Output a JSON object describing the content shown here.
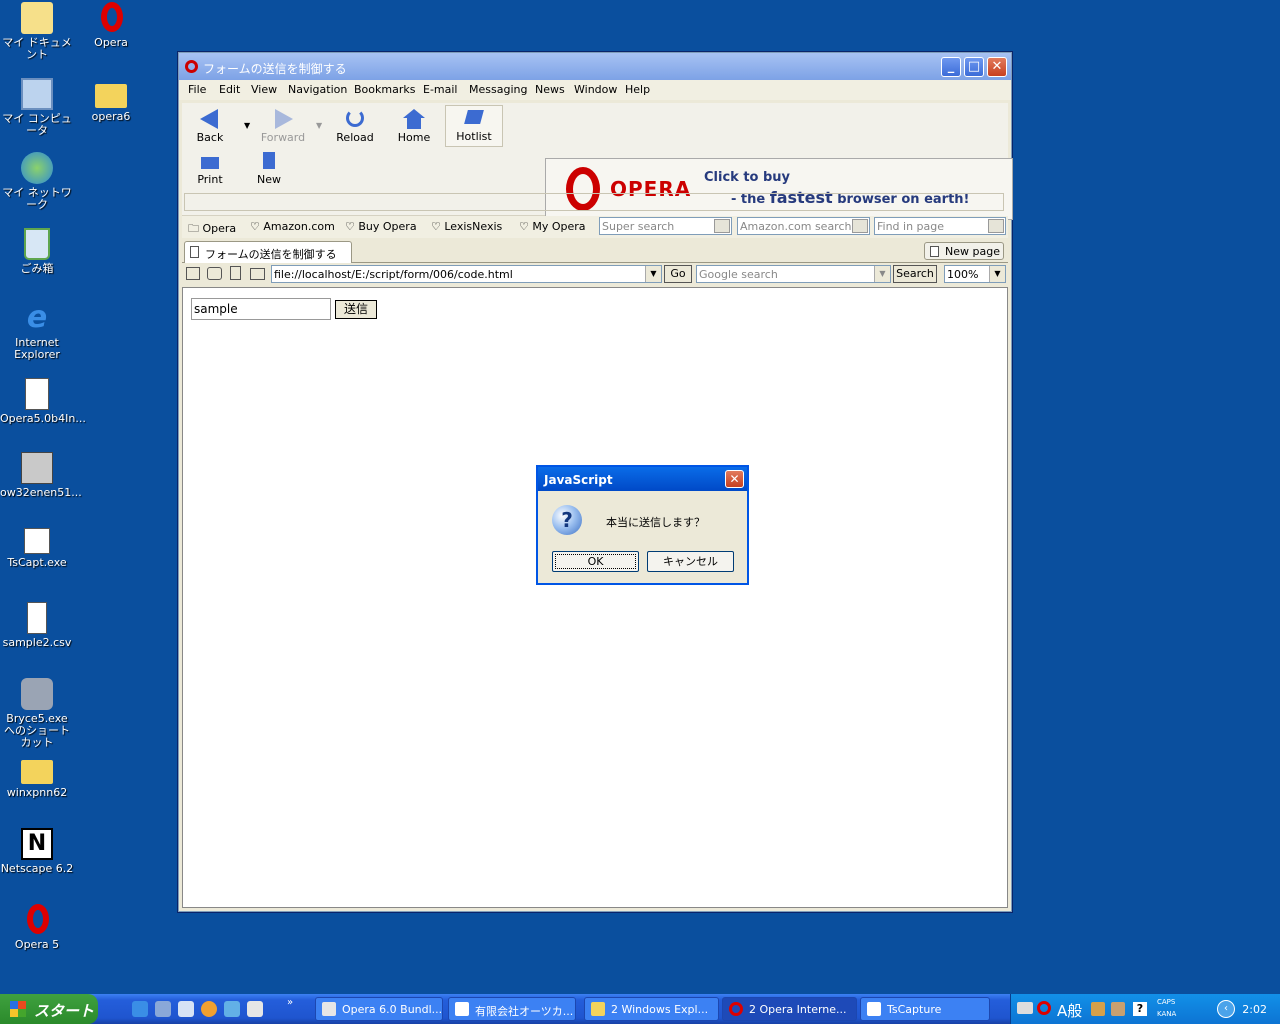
{
  "desktop": {
    "icons": [
      {
        "label": "マイ ドキュメント",
        "icon": "my-documents-icon"
      },
      {
        "label": "Opera",
        "icon": "opera-shortcut-icon"
      },
      {
        "label": "マイ コンピュータ",
        "icon": "my-computer-icon"
      },
      {
        "label": "opera6",
        "icon": "folder-icon"
      },
      {
        "label": "マイ ネットワーク",
        "icon": "my-network-icon"
      },
      {
        "label": "ごみ箱",
        "icon": "recycle-bin-icon"
      },
      {
        "label": "Internet Explorer",
        "icon": "ie-icon"
      },
      {
        "label": "Opera5.0b4In...",
        "icon": "installer-icon"
      },
      {
        "label": "ow32enen51...",
        "icon": "setup-icon"
      },
      {
        "label": "TsCapt.exe",
        "icon": "tscapt-icon"
      },
      {
        "label": "sample2.csv",
        "icon": "csv-file-icon"
      },
      {
        "label": "Bryce5.exe へのショートカット",
        "icon": "bryce-shortcut-icon"
      },
      {
        "label": "winxpnn62",
        "icon": "folder-icon"
      },
      {
        "label": "Netscape 6.2",
        "icon": "netscape-icon"
      },
      {
        "label": "Opera 5",
        "icon": "opera-shortcut-icon"
      }
    ]
  },
  "window": {
    "title": "フォームの送信を制御する",
    "menu": [
      "File",
      "Edit",
      "View",
      "Navigation",
      "Bookmarks",
      "E-mail",
      "Messaging",
      "News",
      "Window",
      "Help"
    ],
    "toolbar": {
      "back": "Back",
      "forward": "Forward",
      "reload": "Reload",
      "home": "Home",
      "hotlist": "Hotlist",
      "print": "Print",
      "new": "New"
    },
    "ad": {
      "brand": "OPERA",
      "line1": "Click to buy",
      "line2_pre": "- the ",
      "line2_bold": "fastest",
      "line2_post": " browser on earth!"
    },
    "personal_bar": [
      "Opera",
      "Amazon.com",
      "Buy Opera",
      "LexisNexis",
      "My Opera"
    ],
    "search_fields": {
      "super": "Super search",
      "amazon": "Amazon.com search",
      "find": "Find in page"
    },
    "tab": {
      "label": "フォームの送信を制御する"
    },
    "new_page": "New page",
    "address": {
      "url": "file://localhost/E:/script/form/006/code.html",
      "go": "Go",
      "google_placeholder": "Google search",
      "search": "Search",
      "zoom": "100%"
    },
    "page": {
      "input_value": "sample",
      "submit_label": "送信"
    }
  },
  "dialog": {
    "title": "JavaScript",
    "message": "本当に送信します？",
    "ok": "OK",
    "cancel": "キャンセル"
  },
  "taskbar": {
    "start": "スタート",
    "tasks": [
      "Opera 6.0 Bundl...",
      "有限会社オーツカ...",
      "2 Windows Expl...",
      "2 Opera Interne...",
      "TsCapture"
    ],
    "tray_caps": "CAPS",
    "tray_kana": "KANA",
    "tray_ime": "A般",
    "clock": "2:02"
  }
}
